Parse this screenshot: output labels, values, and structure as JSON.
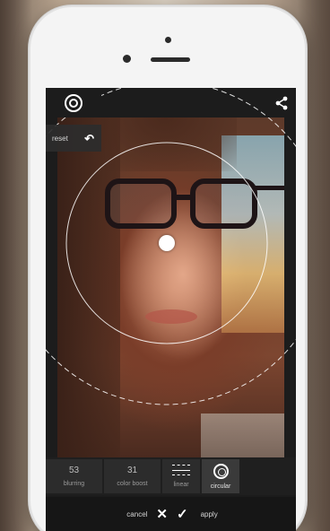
{
  "editor": {
    "top_left_icon": "target-icon",
    "top_right_icon": "share-icon",
    "reset_label": "reset",
    "undo_icon": "undo-arrow-icon"
  },
  "tools": [
    {
      "value": "53",
      "label": "blurring"
    },
    {
      "value": "31",
      "label": "color boost"
    },
    {
      "icon": "linear-icon",
      "label": "linear"
    },
    {
      "icon": "circular-icon",
      "label": "circular",
      "active": true
    }
  ],
  "actions": {
    "cancel_label": "cancel",
    "apply_label": "apply",
    "cancel_icon": "close-icon",
    "apply_icon": "check-icon"
  }
}
